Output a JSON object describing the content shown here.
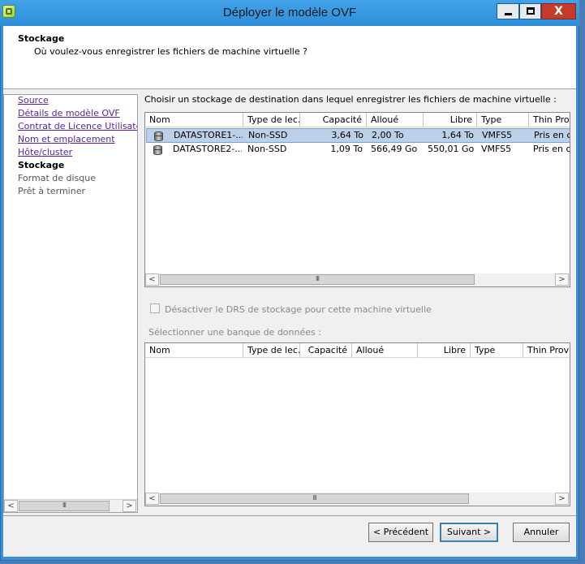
{
  "window": {
    "title": "Déployer le modèle OVF",
    "close_glyph": "X"
  },
  "header": {
    "title": "Stockage",
    "subtitle": "Où voulez-vous enregistrer les fichiers de machine virtuelle ?"
  },
  "nav": {
    "items": [
      {
        "label": "Source",
        "state": "link"
      },
      {
        "label": "Détails de modèle OVF",
        "state": "link"
      },
      {
        "label": "Contrat de Licence Utilisateur F",
        "state": "link"
      },
      {
        "label": "Nom et emplacement",
        "state": "link"
      },
      {
        "label": "Hôte/cluster",
        "state": "link"
      },
      {
        "label": "Stockage",
        "state": "current"
      },
      {
        "label": "Format de disque",
        "state": "disabled"
      },
      {
        "label": "Prêt à terminer",
        "state": "disabled"
      }
    ]
  },
  "content": {
    "choose_label": "Choisir un stockage de destination dans lequel enregistrer les fichiers de machine virtuelle :",
    "drs_checkbox_label": "Désactiver le DRS de stockage pour cette machine virtuelle",
    "drs_checked": false,
    "select_label": "Sélectionner une banque de données :"
  },
  "table1": {
    "columns": [
      "Nom",
      "Type de lec..",
      "Capacité",
      "Alloué",
      "Libre",
      "Type",
      "Thin Prov"
    ],
    "rows": [
      {
        "name": "DATASTORE1-...",
        "disk": "Non-SSD",
        "capacity": "3,64 To",
        "allocated": "2,00 To",
        "free": "1,64 To",
        "type": "VMFS5",
        "thin": "Pris en ch",
        "selected": true
      },
      {
        "name": "DATASTORE2-...",
        "disk": "Non-SSD",
        "capacity": "1,09 To",
        "allocated": "566,49 Go",
        "free": "550,01 Go",
        "type": "VMFS5",
        "thin": "Pris en ch",
        "selected": false
      }
    ]
  },
  "table2": {
    "columns": [
      "Nom",
      "Type de lec..",
      "Capacité",
      "Alloué",
      "Libre",
      "Type",
      "Thin Provi"
    ]
  },
  "scroll": {
    "left": "<",
    "right": ">",
    "thumb": "III"
  },
  "buttons": {
    "prev": "< Précédent",
    "next": "Suivant >",
    "cancel": "Annuler"
  }
}
